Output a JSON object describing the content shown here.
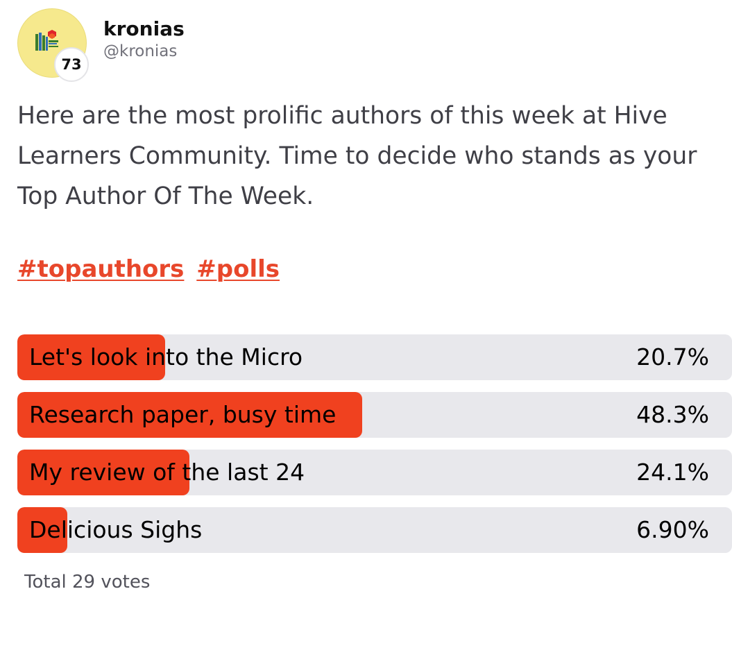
{
  "author": {
    "display_name": "kronias",
    "handle": "@kronias",
    "reputation": "73",
    "avatar_icon": "hive-learners-books-logo"
  },
  "post": {
    "text": "Here are the most prolific authors of this week at Hive Learners Community. Time to decide who stands as your Top Author Of The Week.",
    "tags": [
      "#topauthors",
      "#polls"
    ]
  },
  "poll": {
    "options": [
      {
        "label": "Let's look into the Micro",
        "percent_text": "20.7%",
        "percent": 20.7
      },
      {
        "label": "Research paper, busy time",
        "percent_text": "48.3%",
        "percent": 48.3
      },
      {
        "label": "My review of the last 24",
        "percent_text": "24.1%",
        "percent": 24.1
      },
      {
        "label": "Delicious Sighs",
        "percent_text": "6.90%",
        "percent": 6.9
      }
    ],
    "total": "Total 29 votes"
  },
  "colors": {
    "accent": "#f0411f",
    "link": "#e8472b",
    "track": "#e8e8ec",
    "avatar_bg": "#f6e98d"
  }
}
